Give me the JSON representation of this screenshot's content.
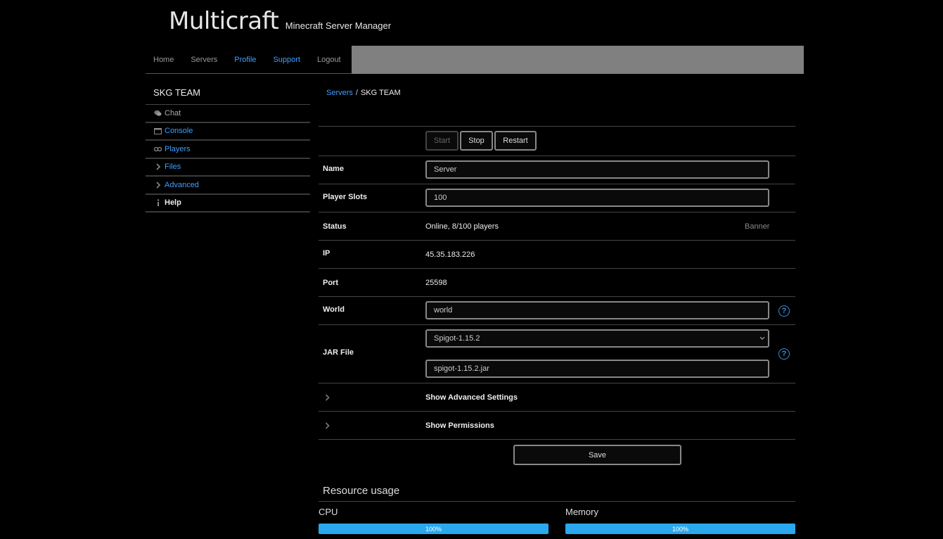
{
  "header": {
    "title": "Multicraft",
    "subtitle": "Minecraft Server Manager"
  },
  "nav": {
    "items": [
      {
        "label": "Home",
        "active": false
      },
      {
        "label": "Servers",
        "active": false
      },
      {
        "label": "Profile",
        "active": true
      },
      {
        "label": "Support",
        "active": true
      },
      {
        "label": "Logout",
        "active": false
      }
    ]
  },
  "sidebar": {
    "title": "SKG TEAM",
    "items": [
      {
        "label": "Chat",
        "icon": "chat-icon"
      },
      {
        "label": "Console",
        "icon": "console-icon"
      },
      {
        "label": "Players",
        "icon": "players-icon"
      },
      {
        "label": "Files",
        "icon": "chevron-right-icon"
      },
      {
        "label": "Advanced",
        "icon": "chevron-right-icon"
      },
      {
        "label": "Help",
        "icon": "info-icon"
      }
    ]
  },
  "breadcrumb": {
    "link": "Servers",
    "separator": "/",
    "current": "SKG TEAM"
  },
  "controls": {
    "start": "Start",
    "stop": "Stop",
    "restart": "Restart"
  },
  "fields": {
    "name": {
      "label": "Name",
      "value": "Server"
    },
    "slots": {
      "label": "Player Slots",
      "value": "100"
    },
    "status": {
      "label": "Status",
      "value": "Online, 8/100 players",
      "banner": "Banner"
    },
    "ip": {
      "label": "IP",
      "value": "45.35.183.226"
    },
    "port": {
      "label": "Port",
      "value": "25598"
    },
    "world": {
      "label": "World",
      "value": "world"
    },
    "jar": {
      "label": "JAR File",
      "select": "Spigot-1.15.2",
      "value": "spigot-1.15.2.jar"
    }
  },
  "help_glyph": "?",
  "toggles": {
    "advanced": "Show Advanced Settings",
    "permissions": "Show Permissions"
  },
  "save": "Save",
  "resources": {
    "title": "Resource usage",
    "cpu": {
      "label": "CPU",
      "percent": 100,
      "text": "100%"
    },
    "memory": {
      "label": "Memory",
      "percent": 100,
      "text": "100%"
    }
  },
  "colors": {
    "accent": "#3fa0ff",
    "bar": "#2aa8ee",
    "nav_bg": "#808080"
  }
}
